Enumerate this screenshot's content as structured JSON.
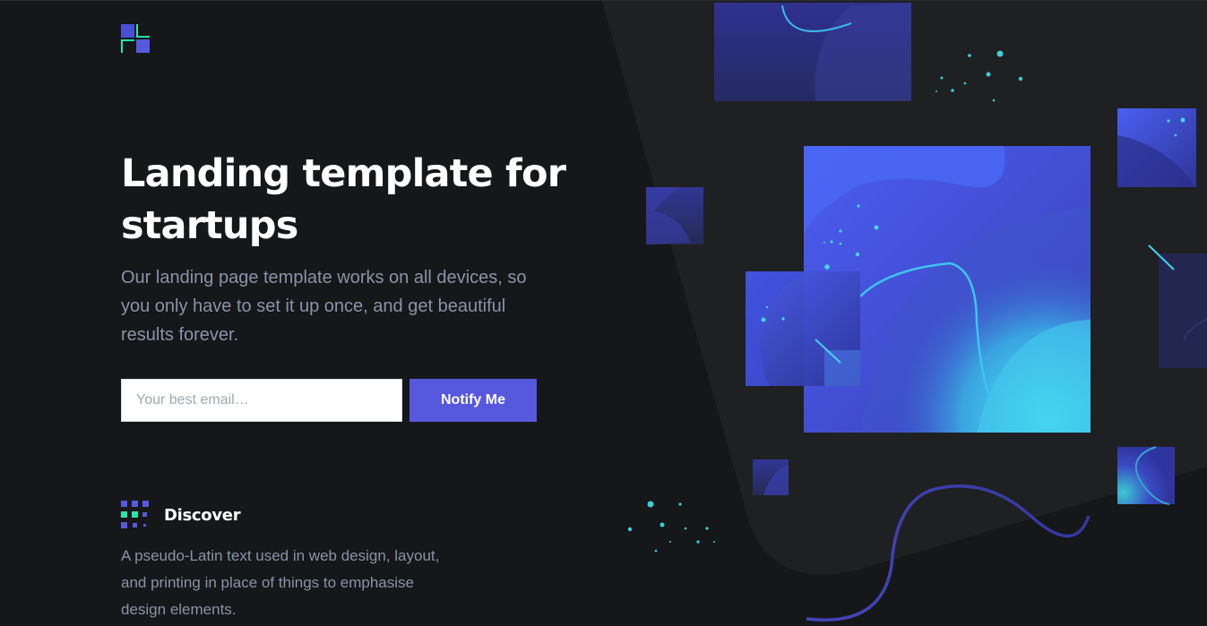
{
  "header": {
    "logo_icon": "brand-logo-squares-icon"
  },
  "hero": {
    "title": "Landing template for startups",
    "paragraph": "Our landing page template works on all devices, so you only have to set it up once, and get beautiful results forever.",
    "email_placeholder": "Your best email…",
    "email_value": "",
    "button_label": "Notify Me"
  },
  "feature": {
    "icon": "grid-dots-icon",
    "title": "Discover",
    "text": "A pseudo-Latin text used in web design, layout, and printing in place of things to emphasise design elements."
  },
  "colors": {
    "background": "#151719",
    "accent": "#5658dd",
    "teal": "#24e5af",
    "cyan": "#4ee3f7",
    "text_muted": "#8a94a7"
  }
}
